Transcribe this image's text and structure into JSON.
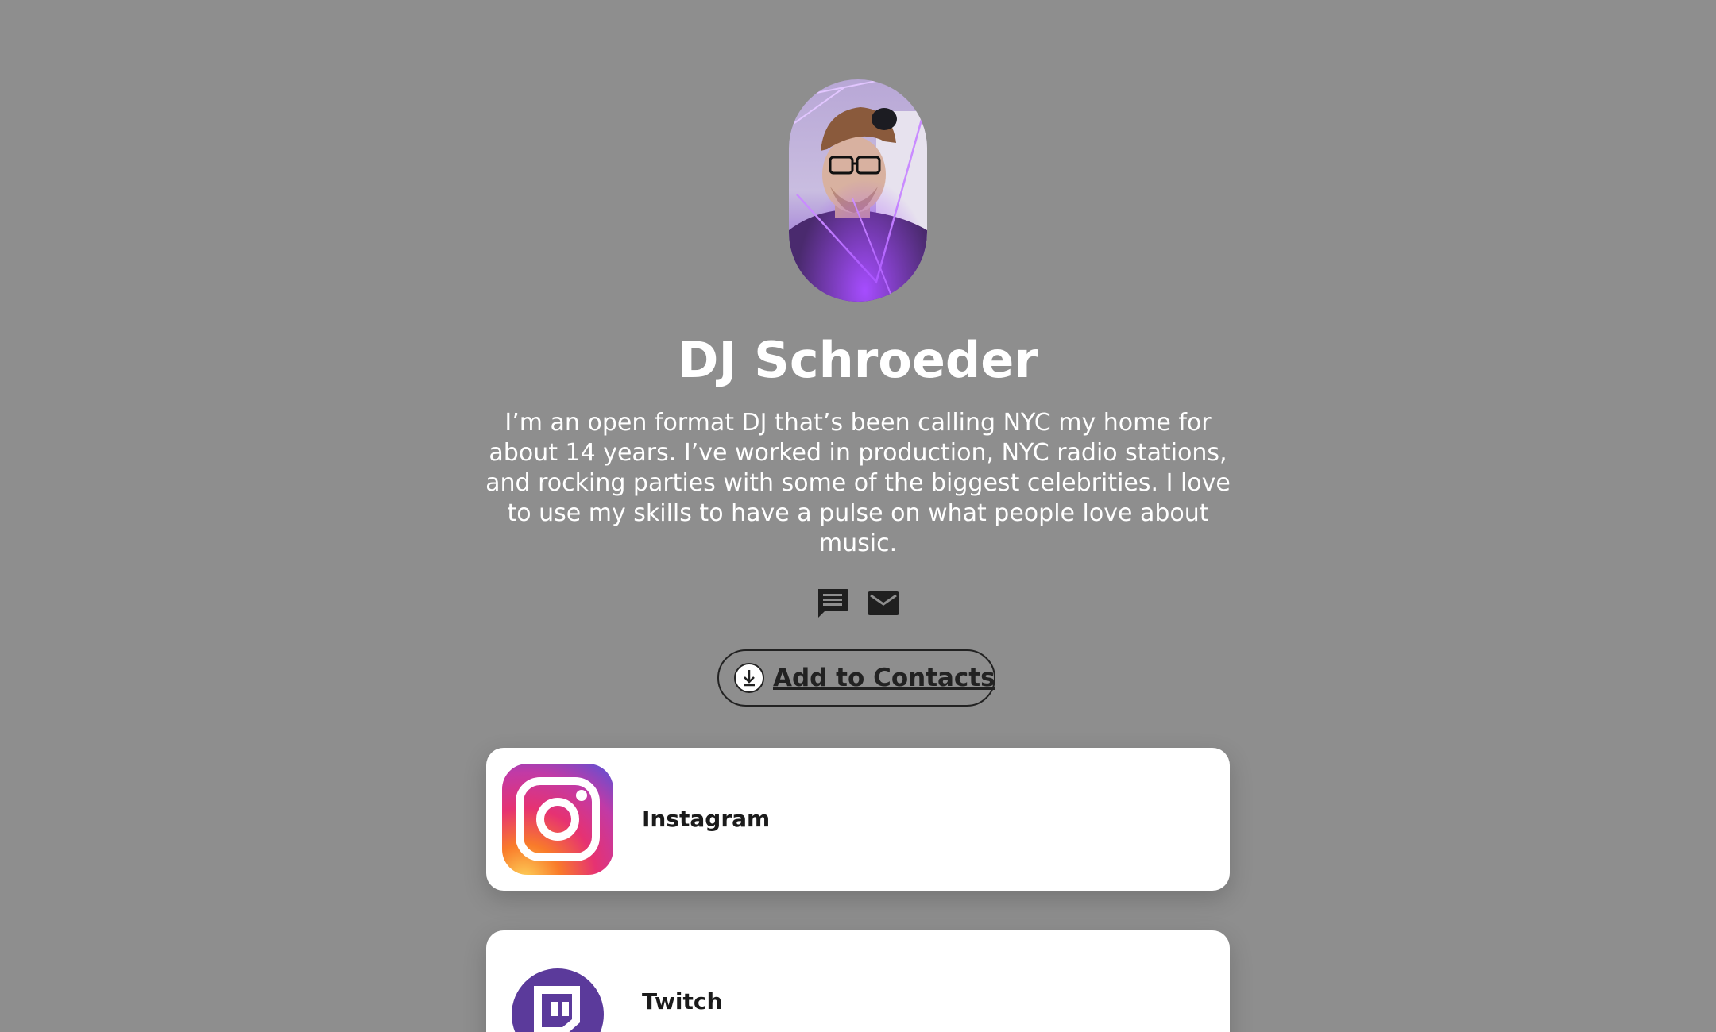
{
  "profile": {
    "name": "DJ Schroeder",
    "bio": "I’m an open format DJ that’s been calling NYC my home for about 14 years. I’ve worked in production, NYC radio stations, and rocking parties with some of the biggest celebrities. I love to use my skills to have a pulse on what people love about music."
  },
  "contact_icons": [
    "message-icon",
    "email-icon"
  ],
  "add_contacts": {
    "label": "Add to Contacts",
    "icon": "download-icon"
  },
  "links": [
    {
      "label": "Instagram",
      "icon": "instagram-logo"
    },
    {
      "label": "Twitch",
      "icon": "twitch-logo"
    }
  ],
  "colors": {
    "background": "#8e8e8e",
    "card": "#ffffff",
    "text_dark": "#222222",
    "text_light": "#ffffff",
    "twitch_purple": "#5b3a9b"
  }
}
